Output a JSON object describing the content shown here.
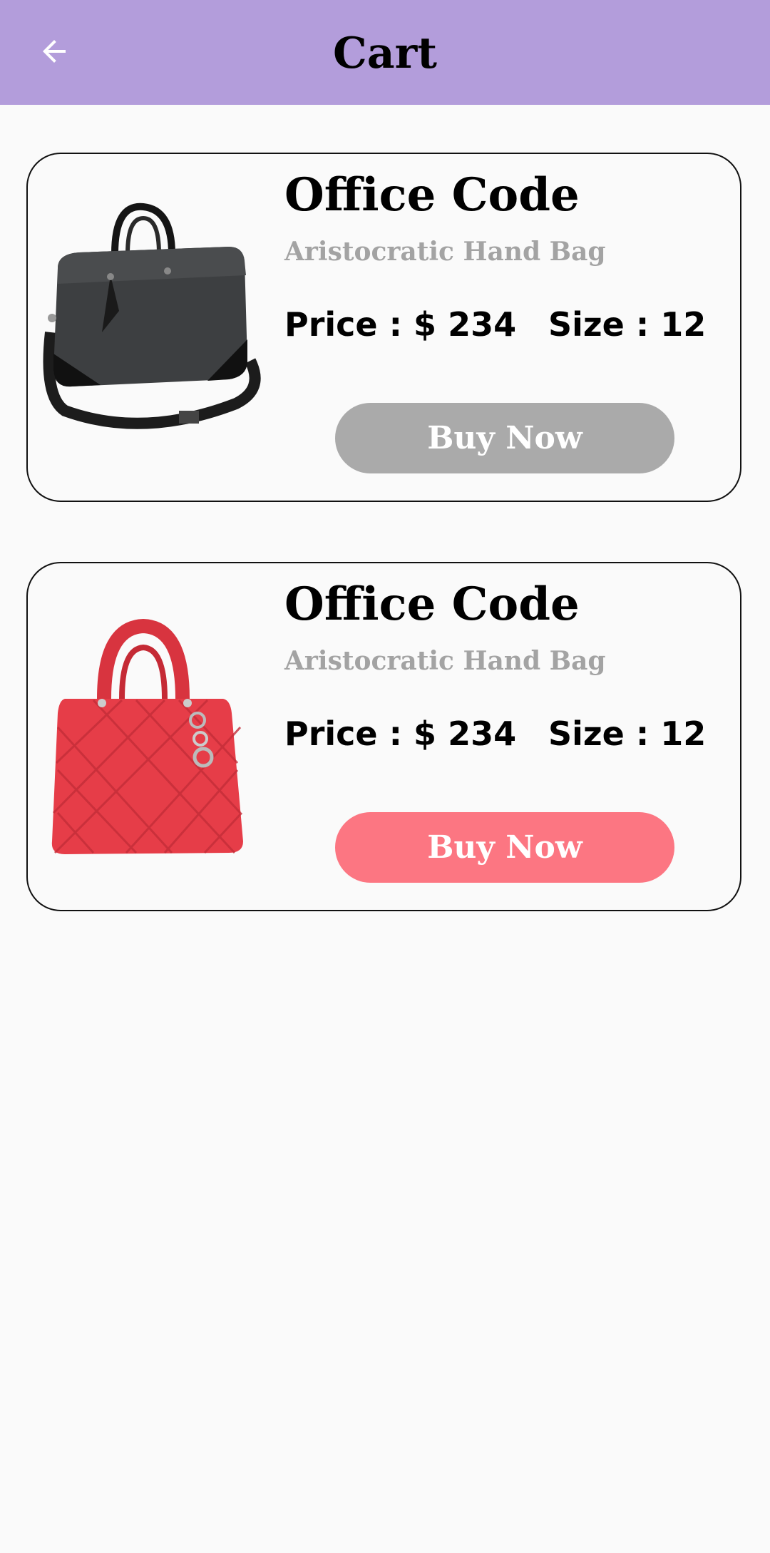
{
  "header": {
    "title": "Cart",
    "back_icon": "arrow-left-icon",
    "background": "#b39ddb"
  },
  "cart_items": [
    {
      "name": "Office Code",
      "subtitle": "Aristocratic Hand Bag",
      "price": "Price : $ 234",
      "size": "Size : 12",
      "button_label": "Buy Now",
      "button_color": "#aaaaaa",
      "image": "gray-laptop-handbag"
    },
    {
      "name": "Office Code",
      "subtitle": "Aristocratic Hand Bag",
      "price": "Price : $ 234",
      "size": "Size : 12",
      "button_label": "Buy Now",
      "button_color": "#fc7682",
      "image": "red-quilted-handbag"
    }
  ]
}
